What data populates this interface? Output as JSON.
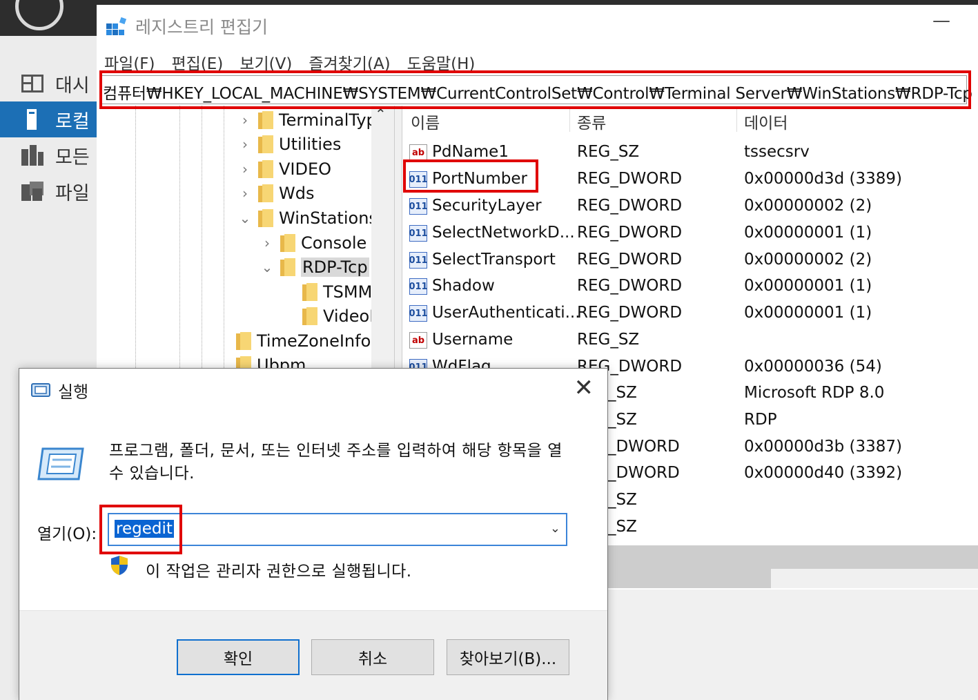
{
  "background": {
    "sidebar": [
      {
        "label": "대시",
        "selected": false
      },
      {
        "label": "로컬",
        "selected": true
      },
      {
        "label": "모든",
        "selected": false
      },
      {
        "label": "파일",
        "selected": false
      }
    ]
  },
  "regedit": {
    "title": "레지스트리 편집기",
    "minimize": "—",
    "menu": [
      "파일(F)",
      "편집(E)",
      "보기(V)",
      "즐겨찾기(A)",
      "도움말(H)"
    ],
    "address": "컴퓨터₩HKEY_LOCAL_MACHINE₩SYSTEM₩CurrentControlSet₩Control₩Terminal Server₩WinStations₩RDP-Tcp",
    "tree": [
      {
        "label": "TerminalTyp",
        "chev": "›"
      },
      {
        "label": "Utilities",
        "chev": "›"
      },
      {
        "label": "VIDEO",
        "chev": "›"
      },
      {
        "label": "Wds",
        "chev": "›"
      },
      {
        "label": "WinStations",
        "chev": "⌄"
      },
      {
        "label": "Console",
        "chev": "›"
      },
      {
        "label": "RDP-Tcp",
        "chev": "⌄"
      },
      {
        "label": "TSMMRemotingAllowedApps",
        "chev": ""
      },
      {
        "label": "VideoRemotingWindowNames",
        "chev": ""
      },
      {
        "label": "TimeZoneInformation",
        "chev": ""
      },
      {
        "label": "Ubpm",
        "chev": ""
      }
    ],
    "columns": {
      "name": "이름",
      "type": "종류",
      "data": "데이터"
    },
    "rows": [
      {
        "icon": "ab",
        "name": "PdName1",
        "type": "REG_SZ",
        "data": "tssecsrv"
      },
      {
        "icon": "011",
        "name": "PortNumber",
        "type": "REG_DWORD",
        "data": "0x00000d3d (3389)"
      },
      {
        "icon": "011",
        "name": "SecurityLayer",
        "type": "REG_DWORD",
        "data": "0x00000002 (2)"
      },
      {
        "icon": "011",
        "name": "SelectNetworkD...",
        "type": "REG_DWORD",
        "data": "0x00000001 (1)"
      },
      {
        "icon": "011",
        "name": "SelectTransport",
        "type": "REG_DWORD",
        "data": "0x00000002 (2)"
      },
      {
        "icon": "011",
        "name": "Shadow",
        "type": "REG_DWORD",
        "data": "0x00000001 (1)"
      },
      {
        "icon": "011",
        "name": "UserAuthenticati...",
        "type": "REG_DWORD",
        "data": "0x00000001 (1)"
      },
      {
        "icon": "ab",
        "name": "Username",
        "type": "REG_SZ",
        "data": ""
      },
      {
        "icon": "011",
        "name": "WdFlag",
        "type": "REG_DWORD",
        "data": "0x00000036 (54)"
      },
      {
        "icon": "",
        "name": "",
        "type": "_SZ",
        "data": "Microsoft RDP 8.0"
      },
      {
        "icon": "",
        "name": "",
        "type": "_SZ",
        "data": "RDP"
      },
      {
        "icon": "",
        "name": "",
        "type": "_DWORD",
        "data": "0x00000d3b (3387)"
      },
      {
        "icon": "",
        "name": "",
        "type": "_DWORD",
        "data": "0x00000d40 (3392)"
      },
      {
        "icon": "",
        "name": "",
        "type": "_SZ",
        "data": ""
      },
      {
        "icon": "",
        "name": "",
        "type": "_SZ",
        "data": ""
      }
    ]
  },
  "run": {
    "title": "실행",
    "close": "✕",
    "description": "프로그램, 폴더, 문서, 또는 인터넷 주소를 입력하여 해당 항목을 열 수 있습니다.",
    "open_label": "열기(O):",
    "input_value": "regedit",
    "dropdown": "⌄",
    "admin_note": "이 작업은 관리자 권한으로 실행됩니다.",
    "buttons": {
      "ok": "확인",
      "cancel": "취소",
      "browse": "찾아보기(B)..."
    }
  },
  "colors": {
    "highlight": "#e00000",
    "selection": "#0a64d2",
    "sidebar_selected": "#1c6fb5"
  }
}
